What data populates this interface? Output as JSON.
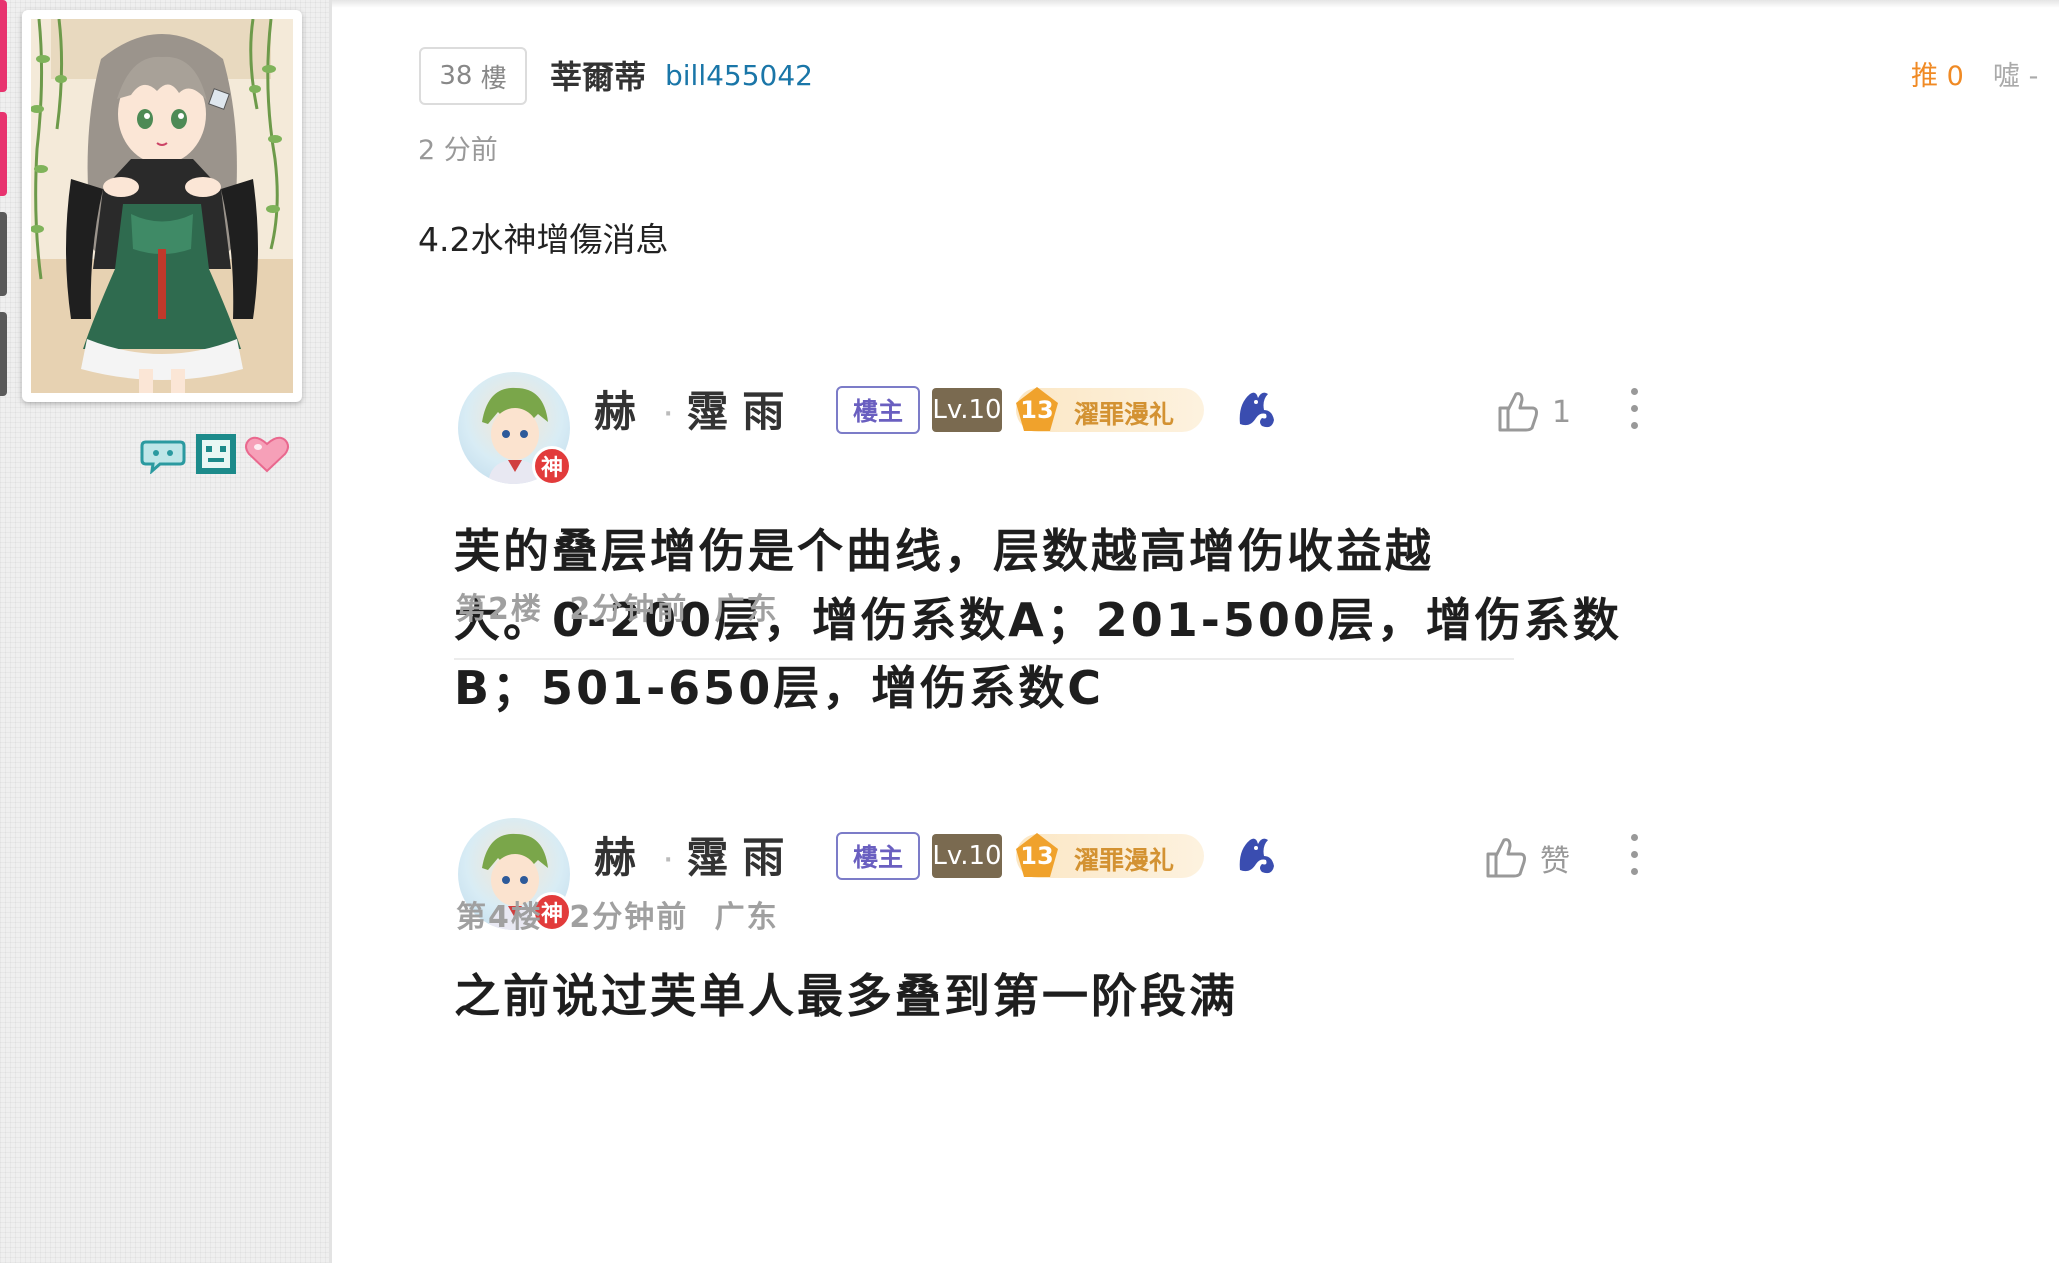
{
  "sidebar": {
    "badges": [
      "chat-bubble-badge",
      "pixel-face-badge",
      "heart-badge"
    ]
  },
  "post": {
    "floor_number": "38",
    "floor_suffix": "樓",
    "author_name": "莘爾蒂",
    "author_id": "bill455042",
    "time": "2 分前",
    "push_label": "推",
    "push_count": "0",
    "boo_label": "噓",
    "boo_count": "-",
    "content": "4.2水神增傷消息"
  },
  "embedded": {
    "replies": [
      {
        "name_first": "赫",
        "name_sep": "·",
        "name_last": "霪雨",
        "op_tag": "樓主",
        "level": "Lv.10",
        "fan_level": "13",
        "fan_title": "濯罪漫礼",
        "god_badge": "神",
        "like_label": "1",
        "text_lines": [
          "芙的叠层增伤是个曲线，层数越高增伤收益越",
          "大。0-200层，增伤系数A；201-500层，增伤系数",
          "B；501-650层，增伤系数C"
        ],
        "meta": "第2楼 2分钟前 广东"
      },
      {
        "name_first": "赫",
        "name_sep": "·",
        "name_last": "霪雨",
        "op_tag": "樓主",
        "level": "Lv.10",
        "fan_level": "13",
        "fan_title": "濯罪漫礼",
        "god_badge": "神",
        "like_label": "赞",
        "text_lines": [
          "之前说过芙单人最多叠到第一阶段满"
        ],
        "meta": "第4楼 2分钟前 广东"
      }
    ]
  },
  "colors": {
    "accent_blue": "#1a76a8",
    "push_orange": "#f08a24",
    "edge_pink": "#e8336f",
    "edge_gray": "#5a5a5a"
  }
}
